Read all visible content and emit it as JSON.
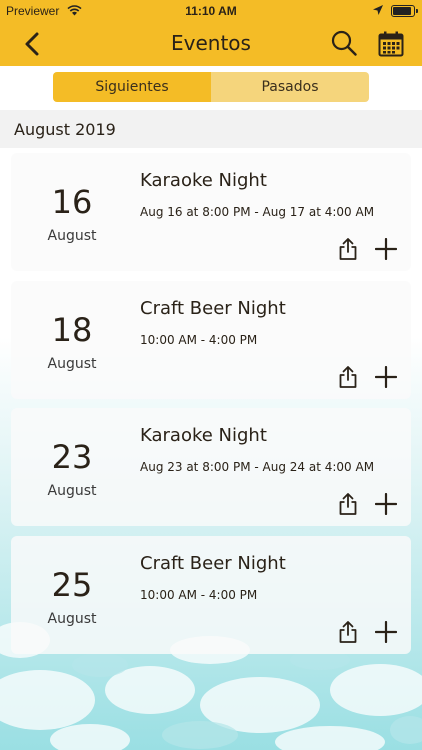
{
  "status_bar": {
    "carrier": "Previewer",
    "time": "11:10 AM"
  },
  "nav": {
    "title": "Eventos"
  },
  "segments": {
    "upcoming": "Siguientes",
    "past": "Pasados"
  },
  "month_header": "August 2019",
  "events": [
    {
      "day": "16",
      "month": "August",
      "name": "Karaoke Night",
      "time": "Aug 16 at 8:00 PM - Aug 17 at 4:00 AM"
    },
    {
      "day": "18",
      "month": "August",
      "name": "Craft Beer Night",
      "time": "10:00 AM - 4:00 PM"
    },
    {
      "day": "23",
      "month": "August",
      "name": "Karaoke Night",
      "time": "Aug 23 at 8:00 PM - Aug 24 at 4:00 AM"
    },
    {
      "day": "25",
      "month": "August",
      "name": "Craft Beer Night",
      "time": "10:00 AM - 4:00 PM"
    }
  ],
  "colors": {
    "accent": "#f4bc26",
    "accent_light": "#f5d57c",
    "water": "#8fd9df"
  },
  "icons": {
    "back": "chevron-left-icon",
    "search": "search-icon",
    "calendar": "calendar-icon",
    "share": "share-icon",
    "add": "plus-icon"
  }
}
